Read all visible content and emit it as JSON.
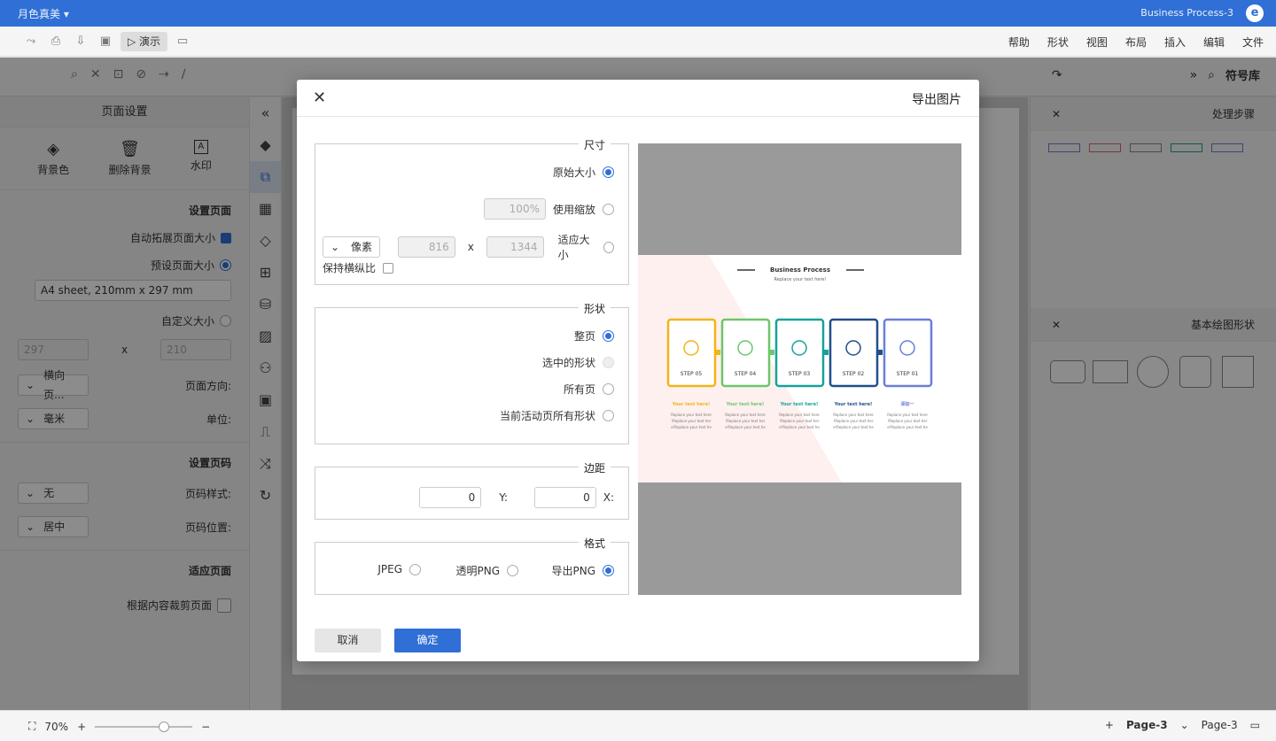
{
  "titlebar": {
    "user": "月色真美 ▾",
    "doc_title": "Business Process-3",
    "logo": "e"
  },
  "menubar": {
    "items": [
      "文件",
      "编辑",
      "插入",
      "布局",
      "视图",
      "形状",
      "帮助"
    ],
    "present": "演示"
  },
  "toolbar": {
    "library_title": "符号库"
  },
  "leftpanel": {
    "title": "页面设置",
    "actions": [
      {
        "label": "背景色",
        "icon": "paint-bucket-icon",
        "glyph": "◈"
      },
      {
        "label": "删除背景",
        "icon": "trash-icon",
        "glyph": "🗑"
      },
      {
        "label": "水印",
        "icon": "watermark-icon",
        "glyph": "A"
      }
    ],
    "page_section": "设置页面",
    "auto_extend": "自动拓展页面大小",
    "preset_size": "预设页面大小",
    "preset_value": "A4 sheet, 210mm x 297 mm",
    "custom_size": "自定义大小",
    "custom_w": "210",
    "custom_h": "297",
    "custom_x": "x",
    "orientation_label": "页面方向:",
    "orientation_value": "横向页...",
    "unit_label": "单位:",
    "unit_value": "毫米",
    "pagenum_section": "设置页码",
    "pagenum_style_label": "页码样式:",
    "pagenum_style_value": "无",
    "pagenum_pos_label": "页码位置:",
    "pagenum_pos_value": "居中",
    "fit_section": "适应页面",
    "fit_crop": "根据内容裁剪页面"
  },
  "rightpanel": {
    "cat1": "处理步骤",
    "cat2": "基本绘图形状"
  },
  "statusbar": {
    "zoom": "70%",
    "page_tab": "Page-3",
    "page_name": "Page-3"
  },
  "dialog": {
    "title": "导出图片",
    "size": {
      "legend": "尺寸",
      "original": "原始大小",
      "scale": "使用缩放",
      "scale_value": "100%",
      "fit": "适应大小",
      "fit_w": "1344",
      "fit_h": "816",
      "x": "x",
      "unit": "像素",
      "keep_ratio": "保持横纵比"
    },
    "shape": {
      "legend": "形状",
      "whole": "整页",
      "selected": "选中的形状",
      "all_pages": "所有页",
      "current_all": "当前活动页所有形状"
    },
    "margin": {
      "legend": "边距",
      "x_label": "X:",
      "x_value": "0",
      "y_label": "Y:",
      "y_value": "0"
    },
    "format": {
      "legend": "格式",
      "png": "导出PNG",
      "tpng": "透明PNG",
      "jpeg": "JPEG"
    },
    "ok": "确定",
    "cancel": "取消"
  },
  "preview": {
    "title": "Business Process",
    "subtitle": "Replace your text here!",
    "steps": [
      "STEP 01",
      "STEP 02",
      "STEP 03",
      "STEP 04",
      "STEP 05"
    ],
    "step_colors": [
      "#6a7fd6",
      "#1f4f8a",
      "#14a39a",
      "#6cc66a",
      "#f2b418"
    ],
    "captions": [
      "添加一",
      "Your text here!",
      "Your text here!",
      "Your text here!",
      "Your text here!"
    ],
    "body": "Replace your text here!Replace your text here!Replace your text here!"
  },
  "colors": {
    "accent": "#2f6fd6"
  }
}
